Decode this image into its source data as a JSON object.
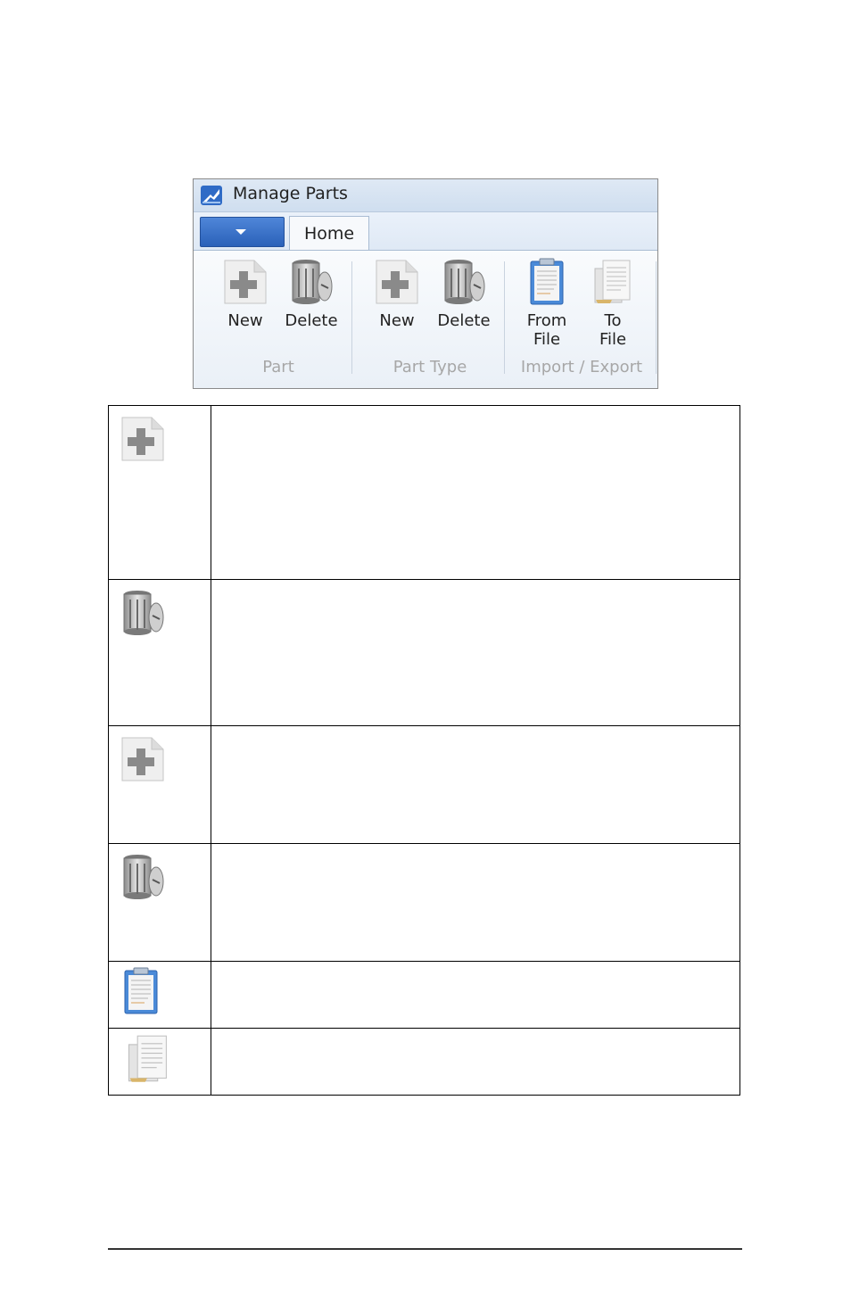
{
  "window": {
    "title": "Manage Parts",
    "tabs": [
      "Home"
    ],
    "groups": [
      {
        "label": "Part",
        "buttons": [
          {
            "label": "New",
            "icon": "new-doc-icon"
          },
          {
            "label": "Delete",
            "icon": "trash-can-icon"
          }
        ]
      },
      {
        "label": "Part Type",
        "buttons": [
          {
            "label": "New",
            "icon": "new-doc-icon"
          },
          {
            "label": "Delete",
            "icon": "trash-can-icon"
          }
        ]
      },
      {
        "label": "Import / Export",
        "buttons": [
          {
            "label_line1": "From",
            "label_line2": "File",
            "icon": "clipboard-icon"
          },
          {
            "label_line1": "To",
            "label_line2": "File",
            "icon": "documents-icon"
          }
        ]
      }
    ]
  },
  "table": {
    "rows": [
      {
        "icon": "new-doc-icon"
      },
      {
        "icon": "trash-can-icon"
      },
      {
        "icon": "new-doc-icon"
      },
      {
        "icon": "trash-can-icon"
      },
      {
        "icon": "clipboard-icon"
      },
      {
        "icon": "documents-icon"
      }
    ]
  },
  "colors": {
    "file_button": "#2f6bc6",
    "ribbon_bg": "#eef3f9",
    "group_label": "#a7a7a7"
  }
}
